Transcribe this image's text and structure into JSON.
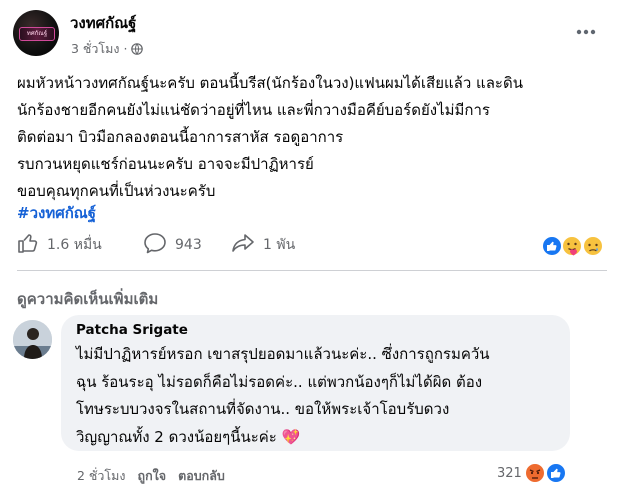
{
  "post": {
    "page_name": "วงทศกัณฐ์",
    "time": "3 ชั่วโมง",
    "dot": "·",
    "text": "ผมหัวหน้าวงทศกัณฐ์นะครับ ตอนนี้บรีส(นักร้องในวง)แฟนผมได้เสียแล้ว และดิน\nนักร้องชายอีกคนยังไม่แน่ชัดว่าอยู่ที่ไหน และพี่กวางมือคีย์บอร์ดยังไม่มีการ\nติดต่อมา บิวมือกลองตอนนี้อาการสาหัส รอดูอาการ\nรบกวนหยุดแชร์ก่อนนะครับ อาจจะมีปาฏิหารย์\nขอบคุณทุกคนที่เป็นห่วงนะครับ",
    "hashtag": "#วงทศกัณฐ์",
    "logo_text": "ทศกัณฐ์",
    "likes": "1.6 หมื่น",
    "comments": "943",
    "shares": "1 พัน",
    "reactions": [
      "like",
      "care",
      "sad"
    ]
  },
  "comments_section": {
    "header": "ดูความคิดเห็นเพิ่มเติม"
  },
  "comment": {
    "author": "Patcha Srigate",
    "text": "ไม่มีปาฏิหารย์หรอก เขาสรุปยอดมาแล้วนะค่ะ.. ซึ่งการถูกรมควัน\nฉุน ร้อนระอุ ไม่รอดก็คือไม่รอดค่ะ.. แต่พวกน้องๆก็ไม่ได้ผิด ต้อง\nโทษระบบวงจรในสถานที่จัดงาน.. ขอให้พระเจ้าโอบรับดวง\nวิญญาณทั้ง 2 ดวงน้อยๆนี้นะค่ะ",
    "emoji": "💖",
    "time": "2 ชั่วโมง",
    "like_label": "ถูกใจ",
    "reply_label": "ตอบกลับ",
    "reaction_count": "321",
    "reactions": [
      "angry",
      "like"
    ]
  },
  "colors": {
    "link": "#1561d6",
    "secondary_text": "#65676b",
    "bubble": "#f0f2f5",
    "like_blue": "#1877f2"
  }
}
